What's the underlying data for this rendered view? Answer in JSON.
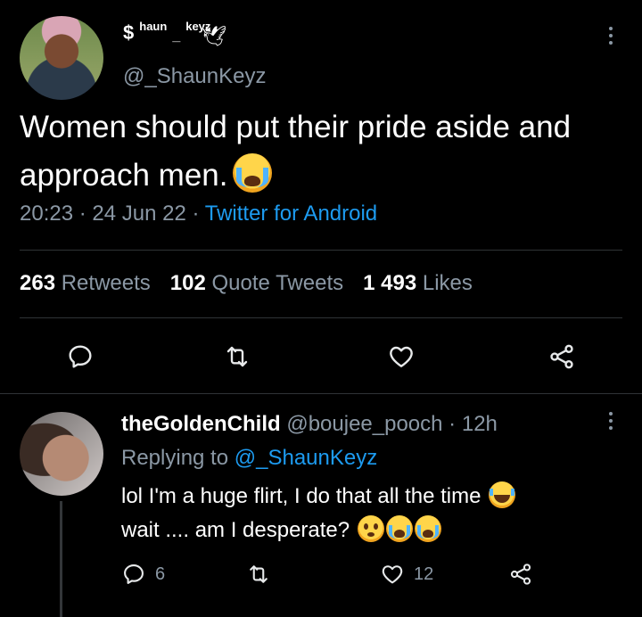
{
  "tweet": {
    "display_name_first": "$",
    "display_name_rest": "haun",
    "display_name_dash": "_",
    "display_name_last": "keyz",
    "handle": "@_ShaunKeyz",
    "text": "Women should put their pride aside and approach men.",
    "emoji": "loudly-crying-face",
    "time": "20:23",
    "date": "24 Jun 22",
    "separator": "·",
    "source": "Twitter for Android",
    "stats": {
      "retweets_count": "263",
      "retweets_label": "Retweets",
      "quotes_count": "102",
      "quotes_label": "Quote Tweets",
      "likes_count": "1 493",
      "likes_label": "Likes"
    }
  },
  "reply": {
    "name": "theGoldenChild",
    "handle": "@boujee_pooch",
    "age": "12h",
    "separator": "·",
    "replying_prefix": "Replying to",
    "replying_to": "@_ShaunKeyz",
    "line1": "lol I'm a huge flirt, I do that all the time",
    "line2": "wait .... am I desperate?",
    "reply_count": "6",
    "like_count": "12"
  },
  "colors": {
    "background": "#000000",
    "text": "#e7e9ea",
    "muted": "#8b98a5",
    "accent": "#1d9bf0",
    "divider": "#2f3336"
  }
}
